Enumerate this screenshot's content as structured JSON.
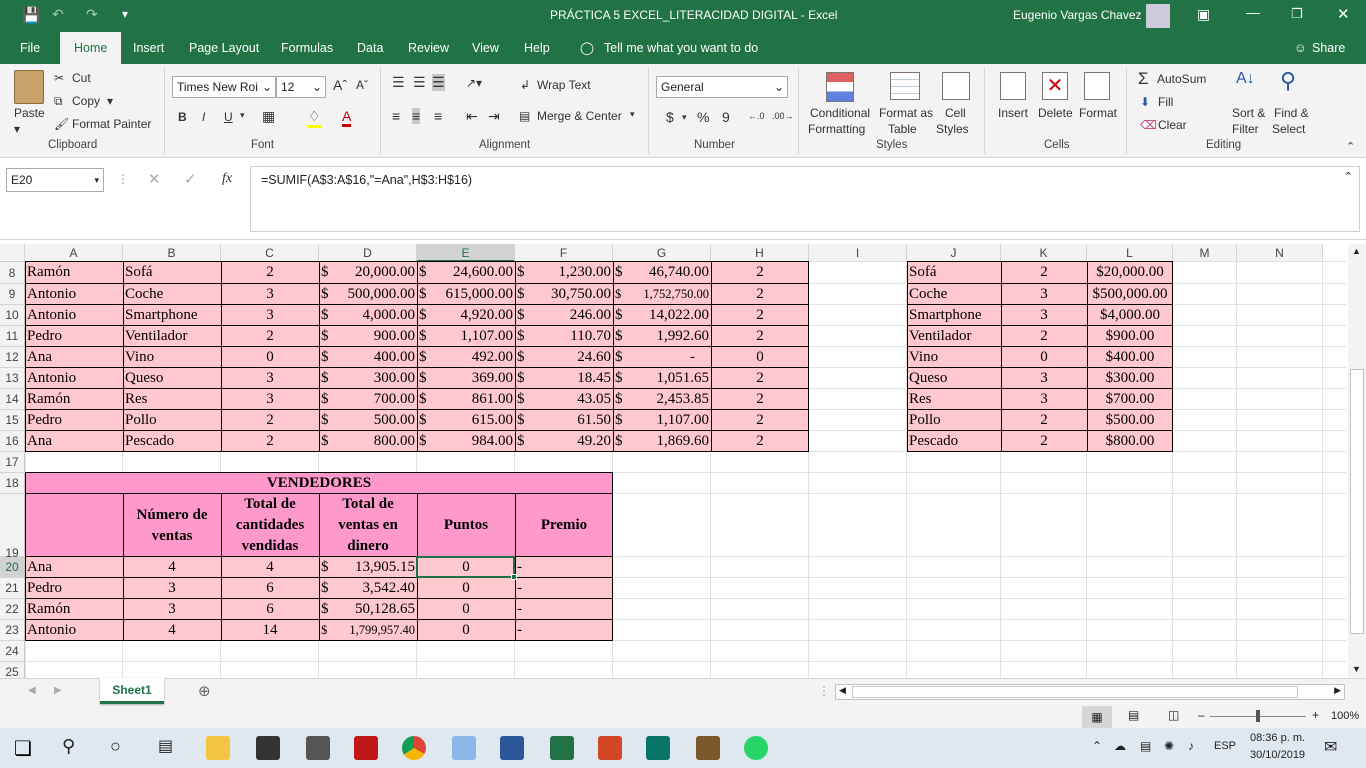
{
  "window": {
    "title": "PRÁCTICA 5 EXCEL_LITERACIDAD DIGITAL  -  Excel",
    "user": "Eugenio Vargas Chavez"
  },
  "tabs": [
    "File",
    "Home",
    "Insert",
    "Page Layout",
    "Formulas",
    "Data",
    "Review",
    "View",
    "Help"
  ],
  "tell_me": "Tell me what you want to do",
  "share": "Share",
  "ribbon": {
    "clipboard": {
      "paste": "Paste",
      "cut": "Cut",
      "copy": "Copy",
      "format_painter": "Format Painter",
      "label": "Clipboard"
    },
    "font": {
      "name": "Times New Roi",
      "size": "12",
      "label": "Font",
      "bold": "B",
      "italic": "I",
      "underline": "U"
    },
    "alignment": {
      "wrap": "Wrap Text",
      "merge": "Merge & Center",
      "label": "Alignment"
    },
    "number": {
      "format": "General",
      "currency": "$",
      "percent": "%",
      "comma": "9",
      "label": "Number"
    },
    "styles": {
      "conditional": "Conditional",
      "conditional2": "Formatting",
      "format_table": "Format as",
      "format_table2": "Table",
      "cell_styles": "Cell",
      "cell_styles2": "Styles",
      "label": "Styles"
    },
    "cells": {
      "insert": "Insert",
      "delete": "Delete",
      "format": "Format",
      "label": "Cells"
    },
    "editing": {
      "autosum": "AutoSum",
      "fill": "Fill",
      "clear": "Clear",
      "sort": "Sort &",
      "sort2": "Filter",
      "find": "Find &",
      "find2": "Select",
      "label": "Editing"
    }
  },
  "formula_bar": {
    "name_box": "E20",
    "fx": "fx",
    "formula": "=SUMIF(A$3:A$16,\"=Ana\",H$3:H$16)"
  },
  "columns": [
    "A",
    "B",
    "C",
    "D",
    "E",
    "F",
    "G",
    "H",
    "I",
    "J",
    "K",
    "L",
    "M",
    "N"
  ],
  "rows": [
    "8",
    "9",
    "10",
    "11",
    "12",
    "13",
    "14",
    "15",
    "16",
    "17",
    "18",
    "19",
    "20",
    "21",
    "22",
    "23",
    "24",
    "25"
  ],
  "sales_table": [
    [
      "Ramón",
      "Sofá",
      "2",
      "20,000.00",
      "24,600.00",
      "1,230.00",
      "46,740.00",
      "2"
    ],
    [
      "Antonio",
      "Coche",
      "3",
      "500,000.00",
      "615,000.00",
      "30,750.00",
      "1,752,750.00",
      "2"
    ],
    [
      "Antonio",
      "Smartphone",
      "3",
      "4,000.00",
      "4,920.00",
      "246.00",
      "14,022.00",
      "2"
    ],
    [
      "Pedro",
      "Ventilador",
      "2",
      "900.00",
      "1,107.00",
      "110.70",
      "1,992.60",
      "2"
    ],
    [
      "Ana",
      "Vino",
      "0",
      "400.00",
      "492.00",
      "24.60",
      "-",
      "0"
    ],
    [
      "Antonio",
      "Queso",
      "3",
      "300.00",
      "369.00",
      "18.45",
      "1,051.65",
      "2"
    ],
    [
      "Ramón",
      "Res",
      "3",
      "700.00",
      "861.00",
      "43.05",
      "2,453.85",
      "2"
    ],
    [
      "Pedro",
      "Pollo",
      "2",
      "500.00",
      "615.00",
      "61.50",
      "1,107.00",
      "2"
    ],
    [
      "Ana",
      "Pescado",
      "2",
      "800.00",
      "984.00",
      "49.20",
      "1,869.60",
      "2"
    ]
  ],
  "products_table": [
    [
      "Sofá",
      "2",
      "$20,000.00"
    ],
    [
      "Coche",
      "3",
      "$500,000.00"
    ],
    [
      "Smartphone",
      "3",
      "$4,000.00"
    ],
    [
      "Ventilador",
      "2",
      "$900.00"
    ],
    [
      "Vino",
      "0",
      "$400.00"
    ],
    [
      "Queso",
      "3",
      "$300.00"
    ],
    [
      "Res",
      "3",
      "$700.00"
    ],
    [
      "Pollo",
      "2",
      "$500.00"
    ],
    [
      "Pescado",
      "2",
      "$800.00"
    ]
  ],
  "vendedores": {
    "title": "VENDEDORES",
    "headers": [
      "Número de ventas",
      "Total de cantidades vendidas",
      "Total de ventas en dinero",
      "Puntos",
      "Premio"
    ],
    "rows": [
      [
        "Ana",
        "4",
        "4",
        "13,905.15",
        "0",
        "-"
      ],
      [
        "Pedro",
        "3",
        "6",
        "3,542.40",
        "0",
        "-"
      ],
      [
        "Ramón",
        "3",
        "6",
        "50,128.65",
        "0",
        "-"
      ],
      [
        "Antonio",
        "4",
        "14",
        "1,799,957.40",
        "0",
        "-"
      ]
    ]
  },
  "currency_symbol": "$",
  "sheet_tab": "Sheet1",
  "zoom": "100%",
  "taskbar": {
    "lang": "ESP",
    "time": "08:36 p. m.",
    "date": "30/10/2019"
  },
  "colors": {
    "excel_green": "#217346",
    "pink": "#ffc7ce",
    "magenta": "#ff99cc"
  }
}
